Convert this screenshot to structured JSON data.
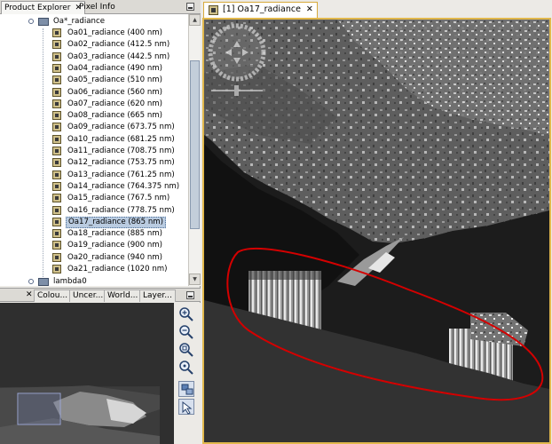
{
  "left_tabs": {
    "product_explorer": "Product Explorer",
    "close": "✕",
    "pixel_info": "Pixel Info"
  },
  "tree": {
    "group_label": "Oa*_radiance",
    "items": [
      "Oa01_radiance (400 nm)",
      "Oa02_radiance (412.5 nm)",
      "Oa03_radiance (442.5 nm)",
      "Oa04_radiance (490 nm)",
      "Oa05_radiance (510 nm)",
      "Oa06_radiance (560 nm)",
      "Oa07_radiance (620 nm)",
      "Oa08_radiance (665 nm)",
      "Oa09_radiance (673.75 nm)",
      "Oa10_radiance (681.25 nm)",
      "Oa11_radiance (708.75 nm)",
      "Oa12_radiance (753.75 nm)",
      "Oa13_radiance (761.25 nm)",
      "Oa14_radiance (764.375 nm)",
      "Oa15_radiance (767.5 nm)",
      "Oa16_radiance (778.75 nm)",
      "Oa17_radiance (865 nm)",
      "Oa18_radiance (885 nm)",
      "Oa19_radiance (900 nm)",
      "Oa20_radiance (940 nm)",
      "Oa21_radiance (1020 nm)"
    ],
    "selected_index": 16,
    "next_group_label": "lambda0"
  },
  "bottom_tabs": {
    "close": "✕",
    "colour": "Colou...",
    "uncertainty": "Uncer...",
    "world": "World...",
    "layer": "Layer..."
  },
  "nav_tools": [
    "zoom-in-icon",
    "zoom-out-icon",
    "zoom-all-icon",
    "zoom-default-icon",
    "sync-views-icon",
    "sync-cursor-icon"
  ],
  "image_view": {
    "tab_label": "[1] Oa17_radiance",
    "close": "✕"
  },
  "colors": {
    "annotation": "#d40000",
    "tab_accent": "#e1b84c",
    "selection": "#b9cbe0"
  }
}
